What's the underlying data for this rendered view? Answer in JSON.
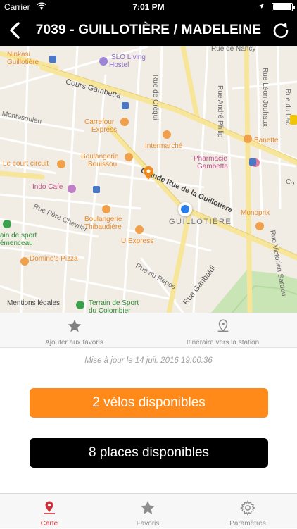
{
  "status_bar": {
    "carrier": "Carrier",
    "time": "7:01 PM"
  },
  "nav": {
    "title": "7039 - GUILLOTIÈRE / MADELEINE"
  },
  "map": {
    "district": "GUILLOTIÈRE",
    "legal": "Mentions légales",
    "labels": {
      "ninkasi": "Ninkasi",
      "ninkasi2": "Guillotière",
      "slo1": "SLO Living",
      "slo2": "Hostel",
      "cours_gambetta": "Cours Gambetta",
      "carrefour1": "Carrefour",
      "carrefour2": "Express",
      "montesquieu": "Montesquieu",
      "boul1a": "Boulangerie",
      "boul1b": "Bouissou",
      "court": "Le court circuit",
      "indo": "Indo Cafe",
      "intermarche": "Intermarché",
      "pharmacie1": "Pharmacie",
      "pharmacie2": "Gambetta",
      "banette": "Banette",
      "grande_rue": "Grande Rue de la Guillotière",
      "boul2a": "Boulangerie",
      "boul2b": "Thibaudière",
      "uexpress": "U Express",
      "sport1a": "ain de sport",
      "sport1b": "émenceau",
      "pere_chevrier": "Rue Père Chevrier",
      "dominos": "Domino's Pizza",
      "monoprix": "Monoprix",
      "rue_repos": "Rue du Repos",
      "rue_garibaldi": "Rue Garibaldi",
      "sport2a": "Terrain de Sport",
      "sport2b": "du Colombier",
      "rue_crequi": "Rue de Créqui",
      "rue_andre_philip": "Rue André Philip",
      "rue_leon_jouhaux": "Rue Léon Jouhaux",
      "rue_du_lac": "Rue du Lac",
      "rue_victorien_sardou": "Rue Victorien Sardou",
      "rue_nancy": "Rue de Nancy",
      "co": "Co"
    }
  },
  "actions": {
    "favorite": "Ajouter aux favoris",
    "route": "Itinéraire vers la station"
  },
  "updated": "Mise à jour le 14 juil. 2016 19:00:36",
  "bikes_button": "2 vélos disponibles",
  "places_button": "8 places disponibles",
  "tabs": [
    {
      "label": "Carte",
      "icon": "map-pin-icon",
      "active": true
    },
    {
      "label": "Favoris",
      "icon": "star-icon",
      "active": false
    },
    {
      "label": "Paramètres",
      "icon": "gear-icon",
      "active": false
    }
  ],
  "colors": {
    "accent_orange": "#ff8a1a",
    "active_tab": "#d0313a",
    "user_location": "#2b7de9"
  }
}
